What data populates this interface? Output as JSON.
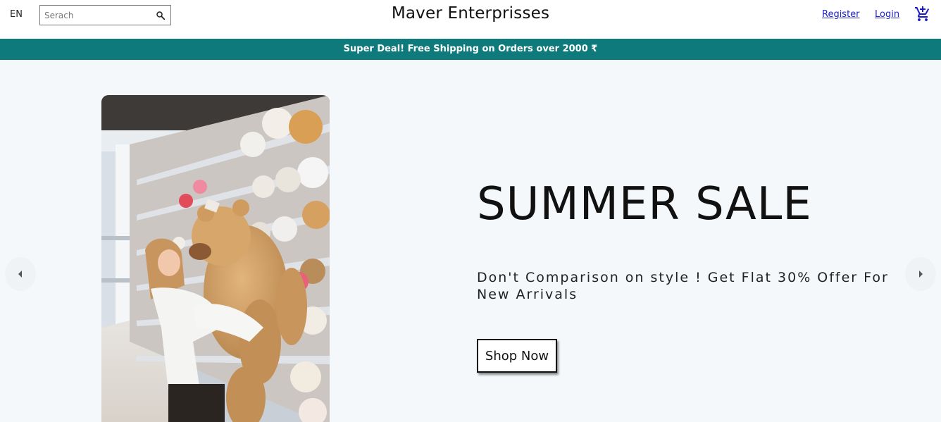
{
  "header": {
    "language": "EN",
    "search": {
      "placeholder": "Serach",
      "value": ""
    },
    "brand": "Maver Enterprisses",
    "links": {
      "register": "Register",
      "login": "Login"
    },
    "cart_icon": "add-shopping-cart-icon"
  },
  "announcement": {
    "text": "Super Deal! Free Shipping on Orders over 2000 ₹"
  },
  "slide": {
    "title": "SUMMER SALE",
    "description": "Don't Comparison on style ! Get Flat 30% Offer For New Arrivals",
    "button_label": "Shop Now",
    "image_subject": "woman hugging giant teddy bear in toy store aisle"
  },
  "slider": {
    "prev_icon": "arrow-left-icon",
    "next_icon": "arrow-right-icon"
  },
  "colors": {
    "announcement_bg": "#0f7a7c",
    "slider_bg": "#f4f8fa",
    "link": "#2222cc"
  }
}
